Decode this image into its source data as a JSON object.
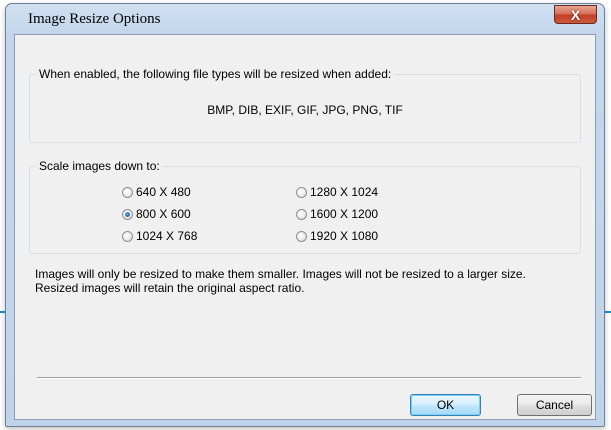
{
  "window": {
    "title": "Image Resize Options",
    "close_glyph": "X"
  },
  "filetypes_group": {
    "legend": "When enabled, the following file types will be resized when added:",
    "types": "BMP, DIB, EXIF, GIF, JPG, PNG, TIF"
  },
  "scale_group": {
    "legend": "Scale images down to:",
    "options": [
      {
        "label": "640 X 480",
        "checked": false
      },
      {
        "label": "800 X 600",
        "checked": true
      },
      {
        "label": "1024 X 768",
        "checked": false
      },
      {
        "label": "1280 X 1024",
        "checked": false
      },
      {
        "label": "1600 X 1200",
        "checked": false
      },
      {
        "label": "1920 X 1080",
        "checked": false
      }
    ]
  },
  "info": {
    "line1": "Images will only be resized to make them smaller.  Images will not be resized to a larger size.",
    "line2": "Resized images will retain the original aspect ratio."
  },
  "buttons": {
    "ok": "OK",
    "cancel": "Cancel"
  }
}
